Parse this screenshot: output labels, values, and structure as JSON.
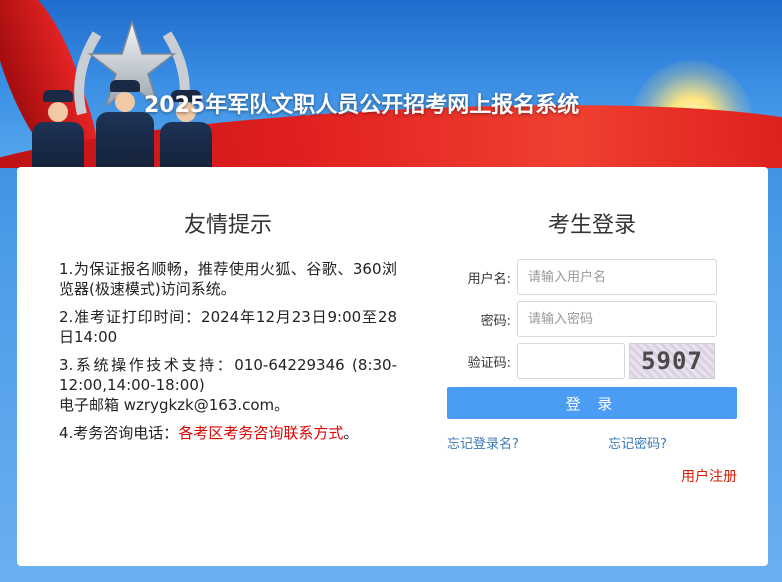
{
  "banner": {
    "title": "2025年军队文职人员公开招考网上报名系统"
  },
  "tips": {
    "title": "友情提示",
    "items": [
      {
        "text": "1.为保证报名顺畅，推荐使用火狐、谷歌、360浏览器(极速模式)访问系统。"
      },
      {
        "text": "2.准考证打印时间：2024年12月23日9:00至28日14:00"
      },
      {
        "line1": "3.系统操作技术支持：010-64229346 (8:30-12:00,14:00-18:00)",
        "line2": "电子邮箱 wzrygkzk@163.com。"
      },
      {
        "prefix": "4.考务咨询电话：",
        "highlight": "各考区考务咨询联系方式",
        "suffix": "。"
      }
    ]
  },
  "login": {
    "title": "考生登录",
    "username_label": "用户名:",
    "username_placeholder": "请输入用户名",
    "password_label": "密码:",
    "password_placeholder": "请输入密码",
    "captcha_label": "验证码:",
    "captcha_value": "5907",
    "submit_label": "登 录",
    "forgot_username": "忘记登录名?",
    "forgot_password": "忘记密码?",
    "register": "用户注册"
  },
  "colors": {
    "accent": "#4a9cf5",
    "alert": "#e00000",
    "link": "#3a78b8"
  }
}
